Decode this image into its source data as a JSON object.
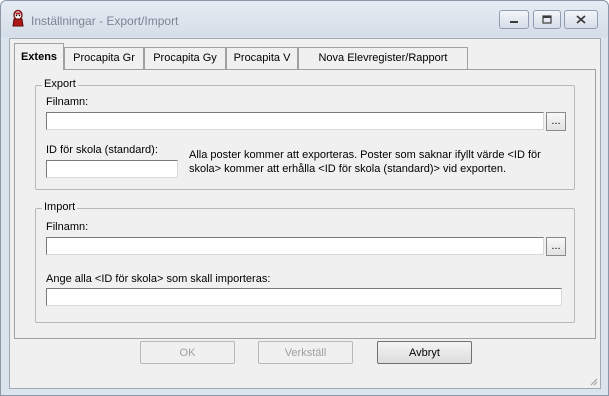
{
  "window": {
    "title": "Inställningar - Export/Import",
    "controls": [
      "minimize-icon",
      "maximize-icon",
      "close-icon"
    ]
  },
  "tabs": [
    {
      "label": "Extens",
      "active": true
    },
    {
      "label": "Procapita Gr",
      "active": false
    },
    {
      "label": "Procapita Gy",
      "active": false
    },
    {
      "label": "Procapita V",
      "active": false
    },
    {
      "label": "Nova Elevregister/Rapport",
      "active": false
    }
  ],
  "export": {
    "legend": "Export",
    "filename_label": "Filnamn:",
    "filename_value": "",
    "browse_label": "...",
    "school_id_label": "ID för skola (standard):",
    "school_id_value": "",
    "note": "Alla poster kommer att exporteras. Poster som saknar ifyllt värde <ID för skola> kommer att erhålla <ID för skola (standard)> vid exporten."
  },
  "import": {
    "legend": "Import",
    "filename_label": "Filnamn:",
    "filename_value": "",
    "browse_label": "...",
    "ids_label": "Ange alla <ID för skola> som skall importeras:",
    "ids_value": ""
  },
  "buttons": {
    "ok": "OK",
    "apply": "Verkställ",
    "cancel": "Avbryt"
  }
}
